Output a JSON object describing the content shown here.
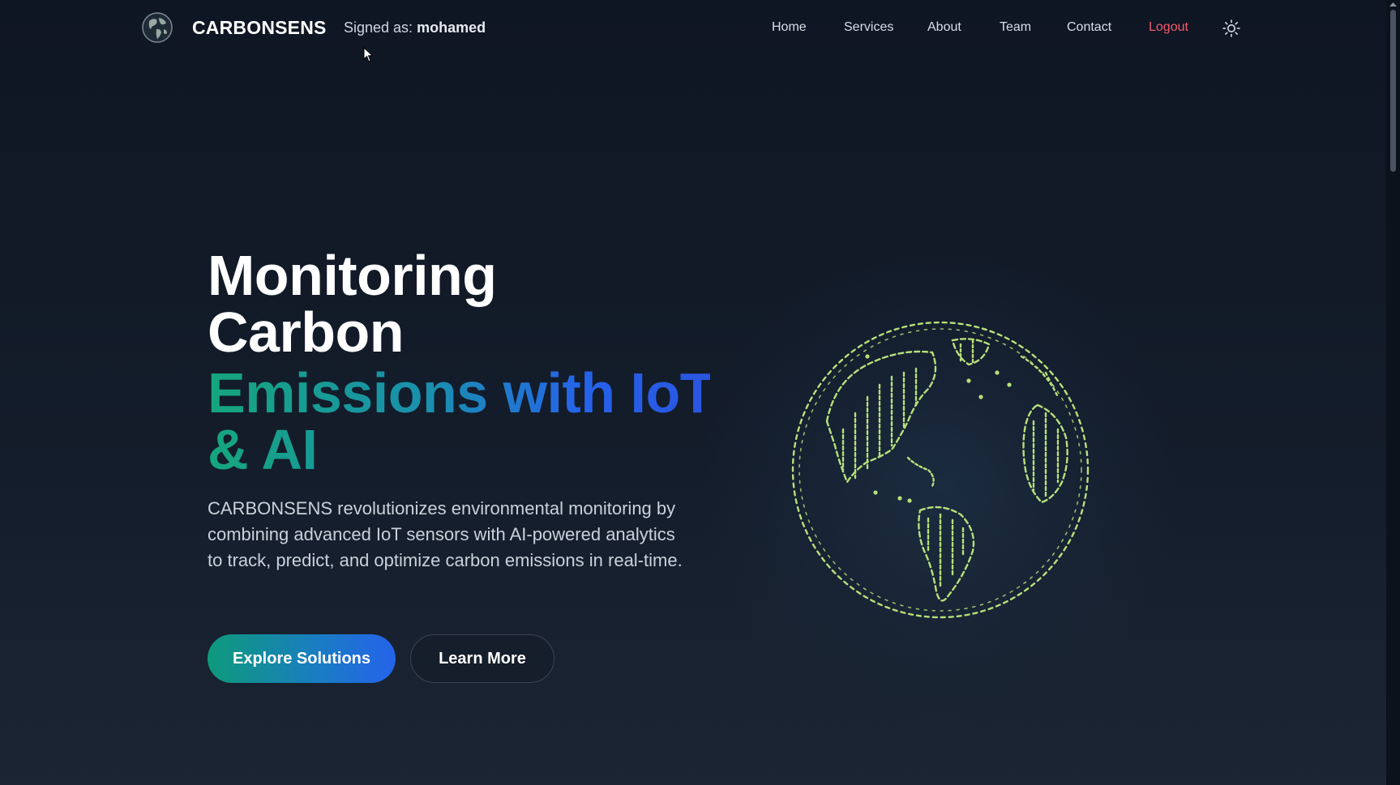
{
  "nav": {
    "brand": "CARBONSENS",
    "signed_prefix": "Signed as:",
    "username": "mohamed",
    "links": [
      "Home",
      "Services",
      "About",
      "Team",
      "Contact"
    ],
    "logout": "Logout",
    "theme_icon": "sun-icon",
    "logo_icon": "globe-logo-icon"
  },
  "hero": {
    "title_line1": "Monitoring",
    "title_line2": "Carbon",
    "accent_line1": "Emissions with IoT",
    "accent_line2": "& AI",
    "description": "CARBONSENS revolutionizes environmental monitoring by combining advanced IoT sensors with AI-powered analytics to track, predict, and optimize carbon emissions in real-time.",
    "primary_button": "Explore Solutions",
    "secondary_button": "Learn More"
  },
  "colors": {
    "background": "#141d2b",
    "accent_green": "#15a67c",
    "accent_blue": "#2563eb",
    "logout_red": "#f45b6b",
    "globe_green": "#b7e07a"
  }
}
